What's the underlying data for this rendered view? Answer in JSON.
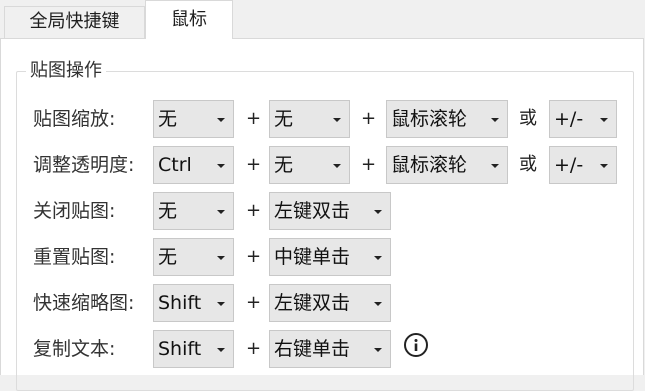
{
  "tabs": [
    {
      "label": "全局快捷键"
    },
    {
      "label": "鼠标"
    }
  ],
  "group": {
    "title": "贴图操作"
  },
  "rows": [
    {
      "label": "贴图缩放:",
      "modifier": "无",
      "plus1": "+",
      "key": "无",
      "plus2": "+",
      "action": "鼠标滚轮",
      "or": "或",
      "alt": "+/-"
    },
    {
      "label": "调整透明度:",
      "modifier": "Ctrl",
      "plus1": "+",
      "key": "无",
      "plus2": "+",
      "action": "鼠标滚轮",
      "or": "或",
      "alt": "+/-"
    },
    {
      "label": "关闭贴图:",
      "modifier": "无",
      "plus1": "+",
      "action": "左键双击"
    },
    {
      "label": "重置贴图:",
      "modifier": "无",
      "plus1": "+",
      "action": "中键单击"
    },
    {
      "label": "快速缩略图:",
      "modifier": "Shift",
      "plus1": "+",
      "action": "左键双击"
    },
    {
      "label": "复制文本:",
      "modifier": "Shift",
      "plus1": "+",
      "action": "右键单击"
    }
  ],
  "icons": {
    "info": "info-circle-icon",
    "dropdown": "chevron-down-icon"
  }
}
